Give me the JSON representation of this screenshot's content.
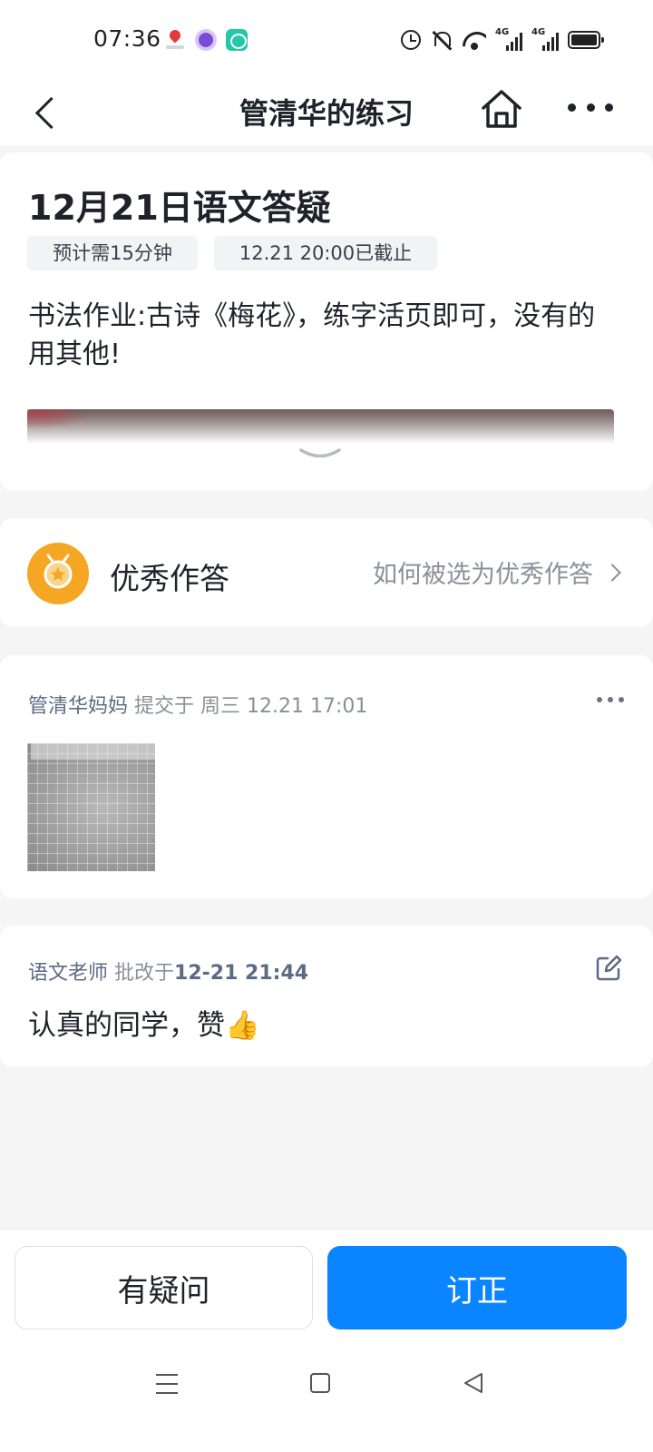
{
  "status_bar": {
    "time": "07:36",
    "notifications": [
      "map-pin-icon",
      "circle-app-icon",
      "chat-app-icon"
    ],
    "network_labels": [
      "4G",
      "4G"
    ]
  },
  "nav": {
    "title": "管清华的练习",
    "icons": [
      "back-arrow-icon",
      "home-icon",
      "more-icon"
    ]
  },
  "homework": {
    "title": "12月21日语文答疑",
    "duration": "预计需15分钟",
    "deadline": "12.21 20:00已截止",
    "body": "书法作业:古诗《梅花》，练字活页即可，没有的用其他!"
  },
  "excellent": {
    "label": "优秀作答",
    "link": "如何被选为优秀作答"
  },
  "submission": {
    "author": "管清华妈妈",
    "action": "提交于",
    "time": "周三 12.21 17:01"
  },
  "review": {
    "author": "语文老师",
    "action": "批改于",
    "time": "12-21 21:44",
    "comment": "认真的同学，赞👍"
  },
  "actions": {
    "question_label": "有疑问",
    "correct_label": "订正"
  },
  "colors": {
    "primary": "#0a84ff",
    "background": "#f5f5f5",
    "medal": "#f5a623",
    "meta_text": "#8a8f99"
  }
}
